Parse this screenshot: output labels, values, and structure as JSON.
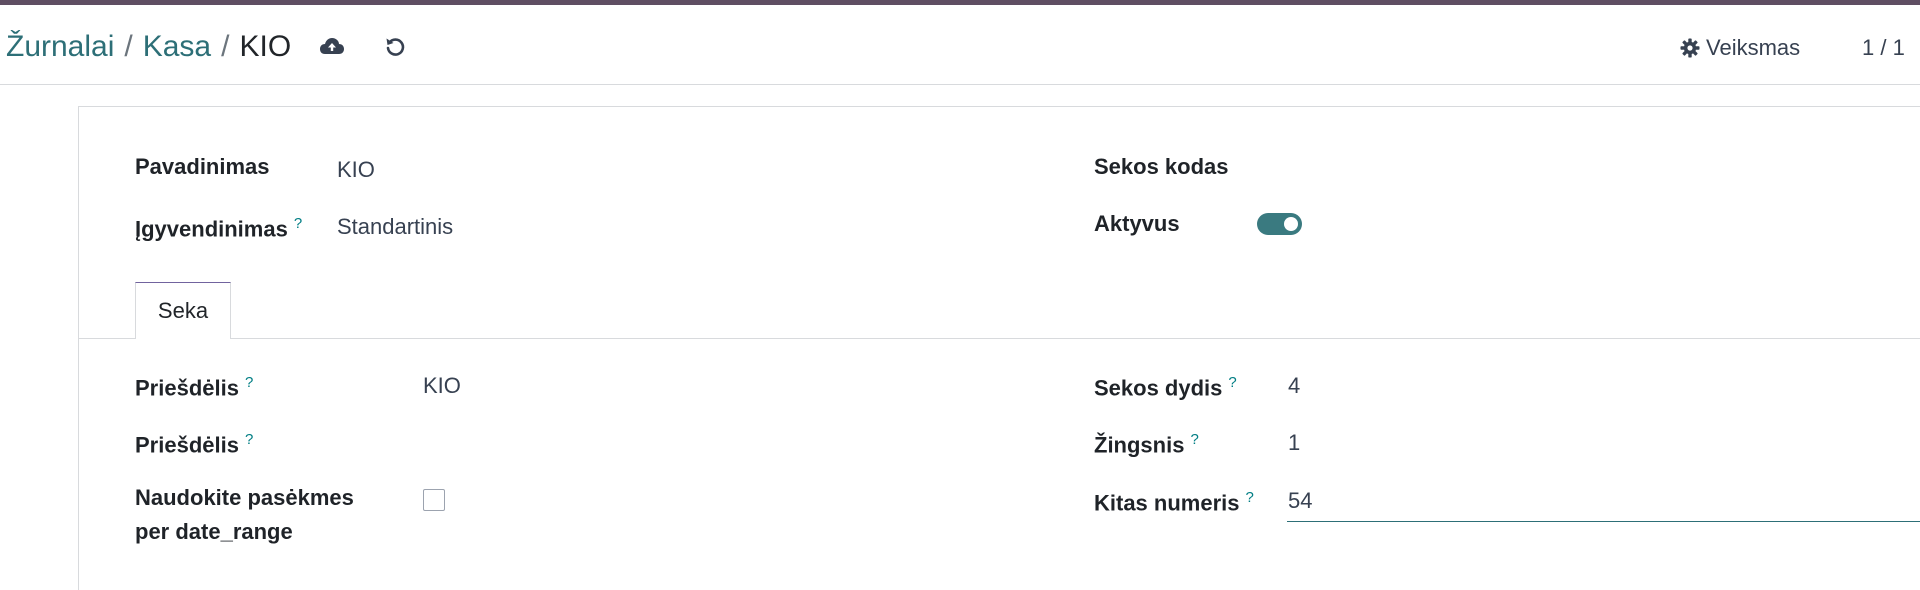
{
  "breadcrumb": {
    "items": [
      "Žurnalai",
      "Kasa"
    ],
    "current": "KIO",
    "separator": "/"
  },
  "toolbar": {
    "save_icon": "cloud-upload-icon",
    "discard_icon": "undo-icon",
    "action_label": "Veiksmas",
    "action_icon": "gear-icon",
    "pager": "1 / 1"
  },
  "form": {
    "left": [
      {
        "label": "Pavadinimas",
        "value": "KIO",
        "help": ""
      },
      {
        "label": "Įgyvendinimas",
        "value": "Standartinis",
        "help": "?"
      }
    ],
    "right": [
      {
        "label": "Sekos kodas",
        "value": ""
      },
      {
        "label": "Aktyvus",
        "toggle_on": true
      }
    ]
  },
  "tabs": [
    {
      "label": "Seka",
      "active": true
    }
  ],
  "sequence": {
    "left": [
      {
        "label": "Priešdėlis",
        "help": "?",
        "value": "KIO"
      },
      {
        "label": "Priešdėlis",
        "help": "?",
        "value": ""
      },
      {
        "label_line1": "Naudokite pasėkmes",
        "label_line2": "per date_range",
        "checked": false
      }
    ],
    "right": [
      {
        "label": "Sekos dydis",
        "help": "?",
        "value": "4"
      },
      {
        "label": "Žingsnis",
        "help": "?",
        "value": "1"
      },
      {
        "label": "Kitas numeris",
        "help": "?",
        "value": "54"
      }
    ]
  },
  "colors": {
    "brand": "#5f4e63",
    "link": "#2d6f77",
    "toggle": "#3a7a80",
    "help": "#017e84"
  }
}
